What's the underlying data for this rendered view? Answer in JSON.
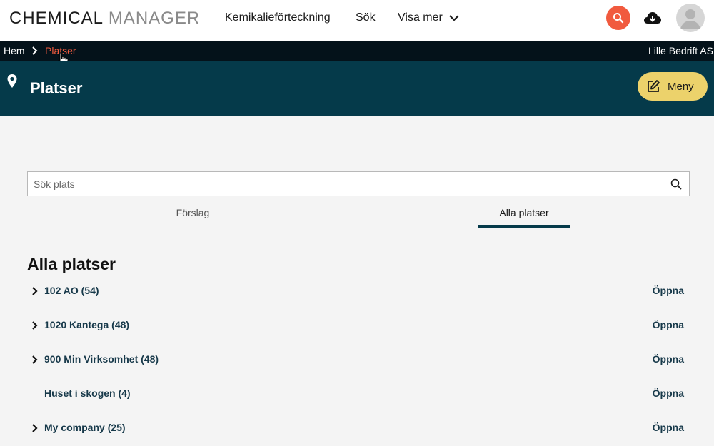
{
  "header": {
    "brand_primary": "CHEMICAL",
    "brand_secondary": "MANAGER",
    "nav": {
      "item1": "Kemikalieförteckning",
      "item2": "Sök",
      "more": "Visa mer"
    },
    "icons": [
      "search-icon",
      "cloud-download-icon",
      "user-avatar-icon",
      "chevron-down-icon"
    ],
    "accent_color": "#f15a3e"
  },
  "breadcrumb": {
    "home": "Hem",
    "current": "Platser",
    "organization": "Lille Bedrift AS"
  },
  "page": {
    "title": "Platser",
    "menu_button": "Meny",
    "header_color": "#053a4a",
    "menu_color": "#ecd26b"
  },
  "search": {
    "placeholder": "Sök plats",
    "value": ""
  },
  "tabs": {
    "suggestions": "Förslag",
    "all": "Alla platser",
    "active": "Alla platser"
  },
  "section": {
    "title": "Alla platser",
    "open_label": "Öppna",
    "rows": [
      {
        "label": "102 AO (54)",
        "expandable": true
      },
      {
        "label": "1020 Kantega (48)",
        "expandable": true
      },
      {
        "label": "900 Min Virksomhet (48)",
        "expandable": true
      },
      {
        "label": "Huset i skogen (4)",
        "expandable": false
      },
      {
        "label": "My company (25)",
        "expandable": true
      }
    ]
  }
}
